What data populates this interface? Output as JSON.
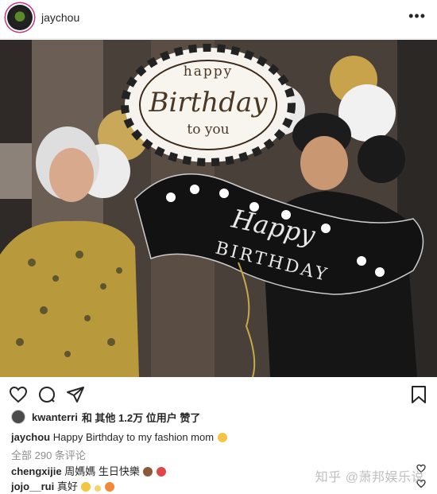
{
  "header": {
    "username": "jaychou",
    "more_label": "•••"
  },
  "post": {
    "balloon_top": {
      "line1": "happy",
      "line2": "Birthday",
      "line3": "to you"
    },
    "balloon_banner": {
      "line1": "Happy",
      "line2": "BIRTHDAY"
    }
  },
  "likes": {
    "first_liker": "kwanterri",
    "text": "和 其他 1.2万 位用户 赞了"
  },
  "caption": {
    "username": "jaychou",
    "text": "Happy Birthday to my fashion mom"
  },
  "comments_summary": "全部 290 条评论",
  "comments": [
    {
      "username": "chengxijie",
      "text": "周媽媽 生日快樂"
    },
    {
      "username": "jojo__rui",
      "text": "真好"
    }
  ],
  "watermark": "知乎 @萧邦娱乐说",
  "colors": {
    "accent_ring": "#c13584",
    "muted_text": "#8e8e8e"
  }
}
